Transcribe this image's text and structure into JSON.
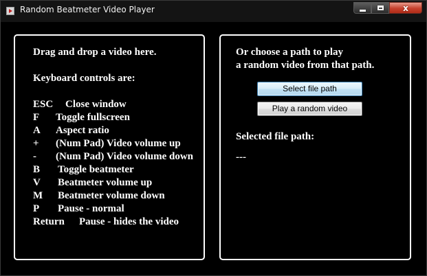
{
  "window": {
    "title": "Random Beatmeter Video Player",
    "close_glyph": "x"
  },
  "left_panel": {
    "drag_drop_text": "Drag and drop a video here.",
    "keyboard_heading": "Keyboard controls are:",
    "controls": [
      {
        "key": "ESC",
        "action": "Close window"
      },
      {
        "key": "F",
        "action": "Toggle fullscreen"
      },
      {
        "key": "A",
        "action": "Aspect ratio"
      },
      {
        "key": "+",
        "action": "(Num Pad) Video volume up"
      },
      {
        "key": "-",
        "action": "(Num Pad) Video volume down"
      },
      {
        "key": "B",
        "action": "Toggle beatmeter"
      },
      {
        "key": "V",
        "action": "Beatmeter volume up"
      },
      {
        "key": "M",
        "action": "Beatmeter volume down"
      },
      {
        "key": "P",
        "action": "Pause - normal"
      },
      {
        "key": "Return",
        "action": "Pause - hides the video"
      }
    ]
  },
  "right_panel": {
    "prompt_line1": "Or choose a path to play",
    "prompt_line2": "a random video from that path.",
    "select_button_label": "Select file path",
    "random_button_label": "Play a random video",
    "selected_path_label": "Selected file path:",
    "selected_path_value": "---"
  },
  "icons": {
    "app": "video-player-icon",
    "minimize": "minimize-icon",
    "maximize": "maximize-icon",
    "close": "close-icon"
  },
  "colors": {
    "background": "#000000",
    "text": "#ffffff",
    "panel_border": "#ffffff",
    "close_button": "#c6412d",
    "select_button_border": "#3c7fb1"
  }
}
